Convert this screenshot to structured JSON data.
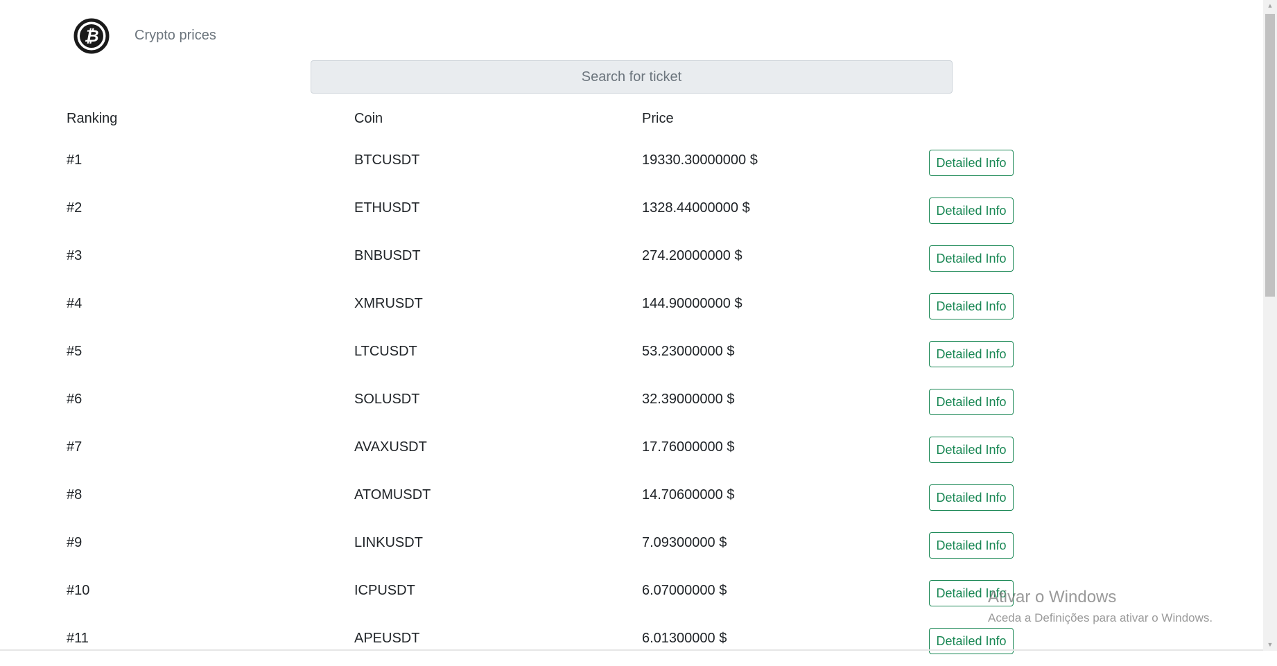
{
  "navbar": {
    "brand": "Crypto prices",
    "logo_icon": "bitcoin-icon"
  },
  "search": {
    "placeholder": "Search for ticket",
    "value": ""
  },
  "table": {
    "headers": [
      "Ranking",
      "Coin",
      "Price",
      ""
    ],
    "button_label": "Detailed Info",
    "rows": [
      {
        "rank": "#1",
        "coin": "BTCUSDT",
        "price": "19330.30000000 $"
      },
      {
        "rank": "#2",
        "coin": "ETHUSDT",
        "price": "1328.44000000 $"
      },
      {
        "rank": "#3",
        "coin": "BNBUSDT",
        "price": "274.20000000 $"
      },
      {
        "rank": "#4",
        "coin": "XMRUSDT",
        "price": "144.90000000 $"
      },
      {
        "rank": "#5",
        "coin": "LTCUSDT",
        "price": "53.23000000 $"
      },
      {
        "rank": "#6",
        "coin": "SOLUSDT",
        "price": "32.39000000 $"
      },
      {
        "rank": "#7",
        "coin": "AVAXUSDT",
        "price": "17.76000000 $"
      },
      {
        "rank": "#8",
        "coin": "ATOMUSDT",
        "price": "14.70600000 $"
      },
      {
        "rank": "#9",
        "coin": "LINKUSDT",
        "price": "7.09300000 $"
      },
      {
        "rank": "#10",
        "coin": "ICPUSDT",
        "price": "6.07000000 $"
      },
      {
        "rank": "#11",
        "coin": "APEUSDT",
        "price": "6.01300000 $"
      }
    ]
  },
  "watermark": {
    "title": "Ativar o Windows",
    "subtitle": "Aceda a Definições para ativar o Windows."
  },
  "colors": {
    "accent": "#198754",
    "search_bg": "#e9ecef",
    "muted": "#6c757d"
  }
}
